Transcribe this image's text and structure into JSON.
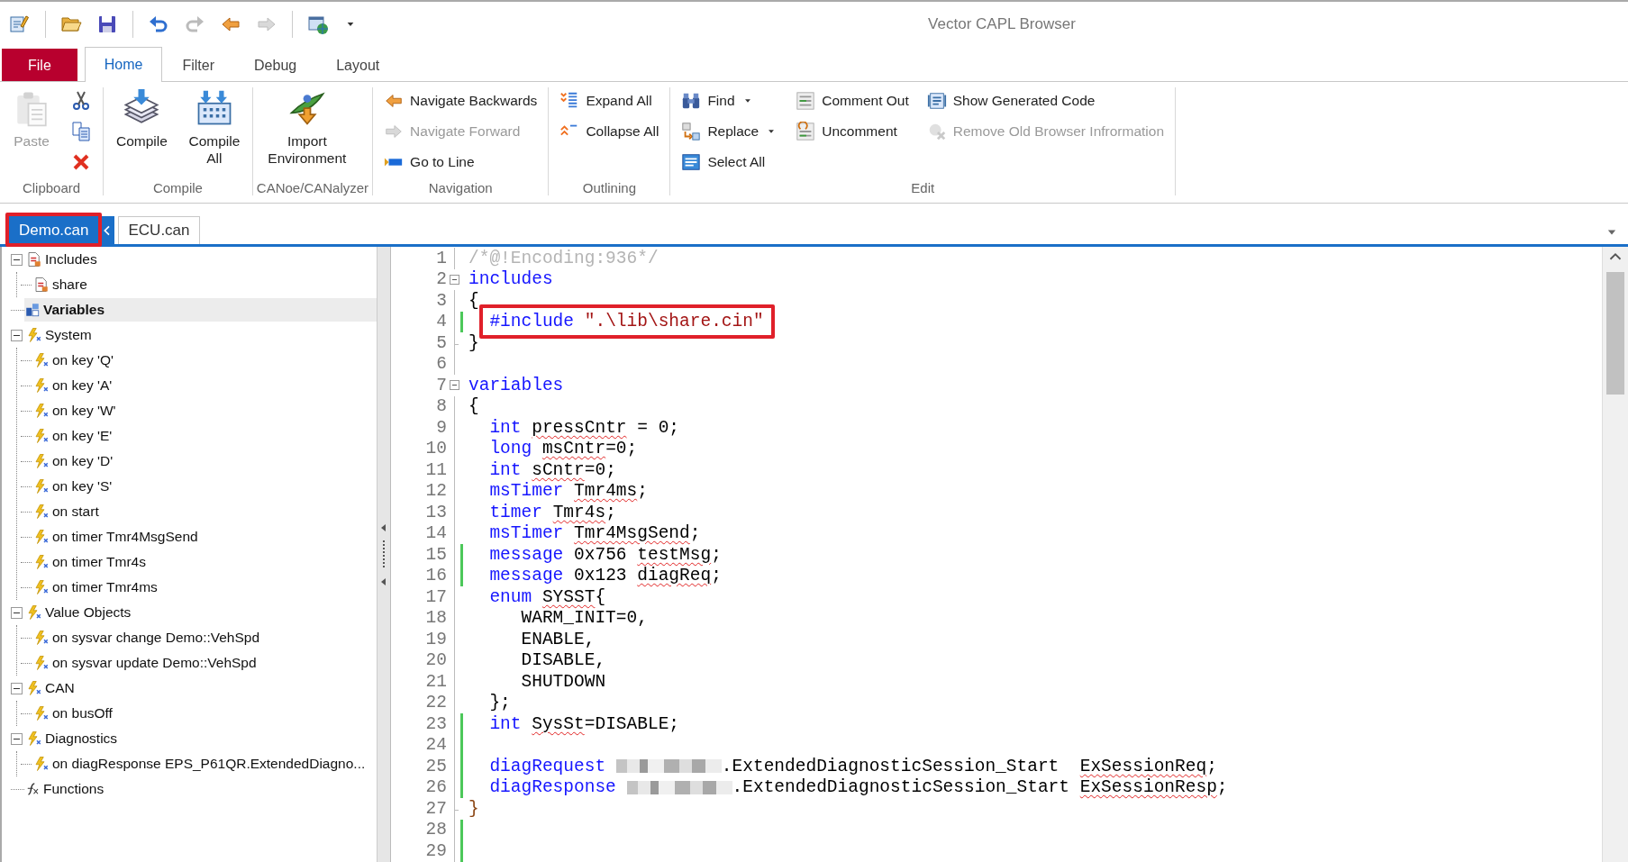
{
  "window": {
    "title": "Vector CAPL Browser"
  },
  "quick_access_toolbar": [
    {
      "disabled": false
    },
    {
      "disabled": false
    },
    {
      "disabled": false
    },
    {
      "disabled": false
    },
    {
      "disabled": true
    },
    {
      "disabled": false
    },
    {
      "disabled": true
    },
    {
      "disabled": false
    },
    {
      "disabled": false
    }
  ],
  "ribbon_tabs": [
    {
      "label": "File",
      "kind": "application",
      "selected": false
    },
    {
      "label": "Home",
      "kind": "tab",
      "selected": true
    },
    {
      "label": "Filter",
      "kind": "tab",
      "selected": false
    },
    {
      "label": "Debug",
      "kind": "tab",
      "selected": false
    },
    {
      "label": "Layout",
      "kind": "tab",
      "selected": false
    }
  ],
  "ribbon_groups": [
    {
      "label": "Clipboard",
      "large": [
        {
          "label": "Paste",
          "disabled": true
        }
      ],
      "columns": [
        [
          {
            "disabled": false
          },
          {
            "disabled": false
          },
          {
            "disabled": false
          }
        ]
      ]
    },
    {
      "label": "Compile",
      "large": [
        {
          "label": "Compile",
          "disabled": false
        },
        {
          "label": "Compile All",
          "disabled": false
        }
      ]
    },
    {
      "label": "CANoe/CANalyzer",
      "large": [
        {
          "label": "Import Environment",
          "disabled": false
        }
      ]
    },
    {
      "label": "Navigation",
      "columns": [
        [
          {
            "label": "Navigate Backwards",
            "disabled": false
          },
          {
            "label": "Navigate Forward",
            "disabled": true
          },
          {
            "label": "Go to Line",
            "disabled": false
          }
        ]
      ]
    },
    {
      "label": "Outlining",
      "columns": [
        [
          {
            "label": "Expand All",
            "disabled": false
          },
          {
            "label": "Collapse All",
            "disabled": false
          }
        ]
      ]
    },
    {
      "label": "Edit",
      "columns": [
        [
          {
            "label": "Find",
            "disabled": false,
            "dropdown": true
          },
          {
            "label": "Replace",
            "disabled": false,
            "dropdown": true
          },
          {
            "label": "Select All",
            "disabled": false
          }
        ],
        [
          {
            "label": "Comment Out",
            "disabled": false
          },
          {
            "label": "Uncomment",
            "disabled": false
          }
        ],
        [
          {
            "label": "Show Generated Code",
            "disabled": false
          },
          {
            "label": "Remove Old Browser Infrormation",
            "disabled": true
          }
        ]
      ]
    }
  ],
  "document_tabs": [
    {
      "label": "Demo.can",
      "selected": true,
      "highlighted": true
    },
    {
      "label": "ECU.can",
      "selected": false,
      "highlighted": false
    }
  ],
  "tree": [
    {
      "label": "Includes",
      "kind": "include",
      "expanded": true,
      "selected": false,
      "children": [
        {
          "label": "share",
          "kind": "include",
          "selected": false
        }
      ]
    },
    {
      "label": "Variables",
      "kind": "variables",
      "selected": true
    },
    {
      "label": "System",
      "kind": "event",
      "expanded": true,
      "selected": false,
      "children": [
        {
          "label": "on key 'Q'",
          "kind": "event",
          "selected": false
        },
        {
          "label": "on key 'A'",
          "kind": "event",
          "selected": false
        },
        {
          "label": "on key 'W'",
          "kind": "event",
          "selected": false
        },
        {
          "label": "on key 'E'",
          "kind": "event",
          "selected": false
        },
        {
          "label": "on key 'D'",
          "kind": "event",
          "selected": false
        },
        {
          "label": "on key 'S'",
          "kind": "event",
          "selected": false
        },
        {
          "label": "on start",
          "kind": "event",
          "selected": false
        },
        {
          "label": "on timer Tmr4MsgSend",
          "kind": "event",
          "selected": false
        },
        {
          "label": "on timer Tmr4s",
          "kind": "event",
          "selected": false
        },
        {
          "label": "on timer Tmr4ms",
          "kind": "event",
          "selected": false
        }
      ]
    },
    {
      "label": "Value Objects",
      "kind": "event",
      "expanded": true,
      "selected": false,
      "children": [
        {
          "label": "on sysvar change Demo::VehSpd",
          "kind": "event",
          "selected": false
        },
        {
          "label": "on sysvar update Demo::VehSpd",
          "kind": "event",
          "selected": false
        }
      ]
    },
    {
      "label": "CAN",
      "kind": "event",
      "expanded": true,
      "selected": false,
      "children": [
        {
          "label": "on busOff",
          "kind": "event",
          "selected": false
        }
      ]
    },
    {
      "label": "Diagnostics",
      "kind": "event",
      "expanded": true,
      "selected": false,
      "children": [
        {
          "label": "on diagResponse EPS_P61QR.ExtendedDiagno...",
          "kind": "event",
          "selected": false
        }
      ]
    },
    {
      "label": "Functions",
      "kind": "functions",
      "selected": false
    }
  ],
  "code": {
    "lines": [
      {
        "number": "1",
        "fold_start": false,
        "fold_end": false,
        "changed": false,
        "segments": [
          {
            "text": "/*@!Encoding:936*/",
            "kind": "comment"
          }
        ]
      },
      {
        "number": "2",
        "fold_start": true,
        "fold_end": false,
        "changed": false,
        "segments": [
          {
            "text": "includes",
            "kind": "keyword"
          }
        ]
      },
      {
        "number": "3",
        "fold_start": false,
        "fold_end": false,
        "changed": false,
        "segments": [
          {
            "text": "{",
            "kind": "plain"
          }
        ]
      },
      {
        "number": "4",
        "fold_start": false,
        "fold_end": false,
        "changed": true,
        "highlighted": true,
        "segments": [
          {
            "text": "  #include",
            "kind": "keyword"
          },
          {
            "text": " \".\\lib\\share.cin\"",
            "kind": "string"
          }
        ]
      },
      {
        "number": "5",
        "fold_start": false,
        "fold_end": true,
        "changed": false,
        "segments": [
          {
            "text": "}",
            "kind": "plain"
          }
        ]
      },
      {
        "number": "6",
        "fold_start": false,
        "fold_end": false,
        "changed": false
      },
      {
        "number": "7",
        "fold_start": true,
        "fold_end": false,
        "changed": false,
        "segments": [
          {
            "text": "variables",
            "kind": "keyword"
          }
        ]
      },
      {
        "number": "8",
        "fold_start": false,
        "fold_end": false,
        "changed": false,
        "segments": [
          {
            "text": "{",
            "kind": "plain"
          }
        ]
      },
      {
        "number": "9",
        "fold_start": false,
        "fold_end": false,
        "changed": false,
        "segments": [
          {
            "text": "  int ",
            "kind": "keyword"
          },
          {
            "text": "pressCntr",
            "kind": "squiggle"
          },
          {
            "text": " = 0;",
            "kind": "plain"
          }
        ]
      },
      {
        "number": "10",
        "fold_start": false,
        "fold_end": false,
        "changed": false,
        "segments": [
          {
            "text": "  long ",
            "kind": "keyword"
          },
          {
            "text": "msCntr",
            "kind": "squiggle"
          },
          {
            "text": "=0;",
            "kind": "plain"
          }
        ]
      },
      {
        "number": "11",
        "fold_start": false,
        "fold_end": false,
        "changed": false,
        "segments": [
          {
            "text": "  int ",
            "kind": "keyword"
          },
          {
            "text": "sCntr",
            "kind": "squiggle"
          },
          {
            "text": "=0;",
            "kind": "plain"
          }
        ]
      },
      {
        "number": "12",
        "fold_start": false,
        "fold_end": false,
        "changed": false,
        "segments": [
          {
            "text": "  msTimer ",
            "kind": "keyword"
          },
          {
            "text": "Tmr4ms",
            "kind": "squiggle"
          },
          {
            "text": ";",
            "kind": "plain"
          }
        ]
      },
      {
        "number": "13",
        "fold_start": false,
        "fold_end": false,
        "changed": false,
        "segments": [
          {
            "text": "  timer ",
            "kind": "keyword"
          },
          {
            "text": "Tmr4s",
            "kind": "squiggle"
          },
          {
            "text": ";",
            "kind": "plain"
          }
        ]
      },
      {
        "number": "14",
        "fold_start": false,
        "fold_end": false,
        "changed": false,
        "segments": [
          {
            "text": "  msTimer ",
            "kind": "keyword"
          },
          {
            "text": "Tmr4MsgSend",
            "kind": "squiggle"
          },
          {
            "text": ";",
            "kind": "plain"
          }
        ]
      },
      {
        "number": "15",
        "fold_start": false,
        "fold_end": false,
        "changed": true,
        "segments": [
          {
            "text": "  message ",
            "kind": "keyword"
          },
          {
            "text": "0x756 ",
            "kind": "plain"
          },
          {
            "text": "testMsg",
            "kind": "squiggle"
          },
          {
            "text": ";",
            "kind": "plain"
          }
        ]
      },
      {
        "number": "16",
        "fold_start": false,
        "fold_end": false,
        "changed": true,
        "segments": [
          {
            "text": "  message ",
            "kind": "keyword"
          },
          {
            "text": "0x123 ",
            "kind": "plain"
          },
          {
            "text": "diagReq",
            "kind": "squiggle"
          },
          {
            "text": ";",
            "kind": "plain"
          }
        ]
      },
      {
        "number": "17",
        "fold_start": false,
        "fold_end": false,
        "changed": false,
        "segments": [
          {
            "text": "  enum ",
            "kind": "keyword"
          },
          {
            "text": "SYSST",
            "kind": "squiggle"
          },
          {
            "text": "{",
            "kind": "plain"
          }
        ]
      },
      {
        "number": "18",
        "fold_start": false,
        "fold_end": false,
        "changed": false,
        "segments": [
          {
            "text": "     WARM_INIT=0,",
            "kind": "plain"
          }
        ]
      },
      {
        "number": "19",
        "fold_start": false,
        "fold_end": false,
        "changed": false,
        "segments": [
          {
            "text": "     ENABLE,",
            "kind": "plain"
          }
        ]
      },
      {
        "number": "20",
        "fold_start": false,
        "fold_end": false,
        "changed": false,
        "segments": [
          {
            "text": "     DISABLE,",
            "kind": "plain"
          }
        ]
      },
      {
        "number": "21",
        "fold_start": false,
        "fold_end": false,
        "changed": false,
        "segments": [
          {
            "text": "     SHUTDOWN",
            "kind": "plain"
          }
        ]
      },
      {
        "number": "22",
        "fold_start": false,
        "fold_end": false,
        "changed": false,
        "segments": [
          {
            "text": "  };",
            "kind": "plain"
          }
        ]
      },
      {
        "number": "23",
        "fold_start": false,
        "fold_end": false,
        "changed": true,
        "segments": [
          {
            "text": "  int ",
            "kind": "keyword"
          },
          {
            "text": "SysSt",
            "kind": "squiggle"
          },
          {
            "text": "=DISABLE;",
            "kind": "plain"
          }
        ]
      },
      {
        "number": "24",
        "fold_start": false,
        "fold_end": false,
        "changed": true
      },
      {
        "number": "25",
        "fold_start": false,
        "fold_end": false,
        "changed": true,
        "segments": [
          {
            "text": "  diagRequest ",
            "kind": "keyword"
          },
          {
            "kind": "redacted"
          },
          {
            "text": ".ExtendedDiagnosticSession_Start  ",
            "kind": "plain"
          },
          {
            "text": "ExSessionReq",
            "kind": "squiggle"
          },
          {
            "text": ";",
            "kind": "plain"
          }
        ]
      },
      {
        "number": "26",
        "fold_start": false,
        "fold_end": false,
        "changed": true,
        "segments": [
          {
            "text": "  diagResponse ",
            "kind": "keyword"
          },
          {
            "kind": "redacted"
          },
          {
            "text": ".ExtendedDiagnosticSession_Start ",
            "kind": "plain"
          },
          {
            "text": "ExSessionResp",
            "kind": "squiggle"
          },
          {
            "text": ";",
            "kind": "plain"
          }
        ]
      },
      {
        "number": "27",
        "fold_start": false,
        "fold_end": true,
        "changed": false,
        "segments": [
          {
            "text": "}",
            "kind": "brace_match"
          }
        ]
      },
      {
        "number": "28",
        "fold_start": false,
        "fold_end": false,
        "changed": true
      },
      {
        "number": "29",
        "fold_start": false,
        "fold_end": false,
        "changed": true
      }
    ]
  }
}
